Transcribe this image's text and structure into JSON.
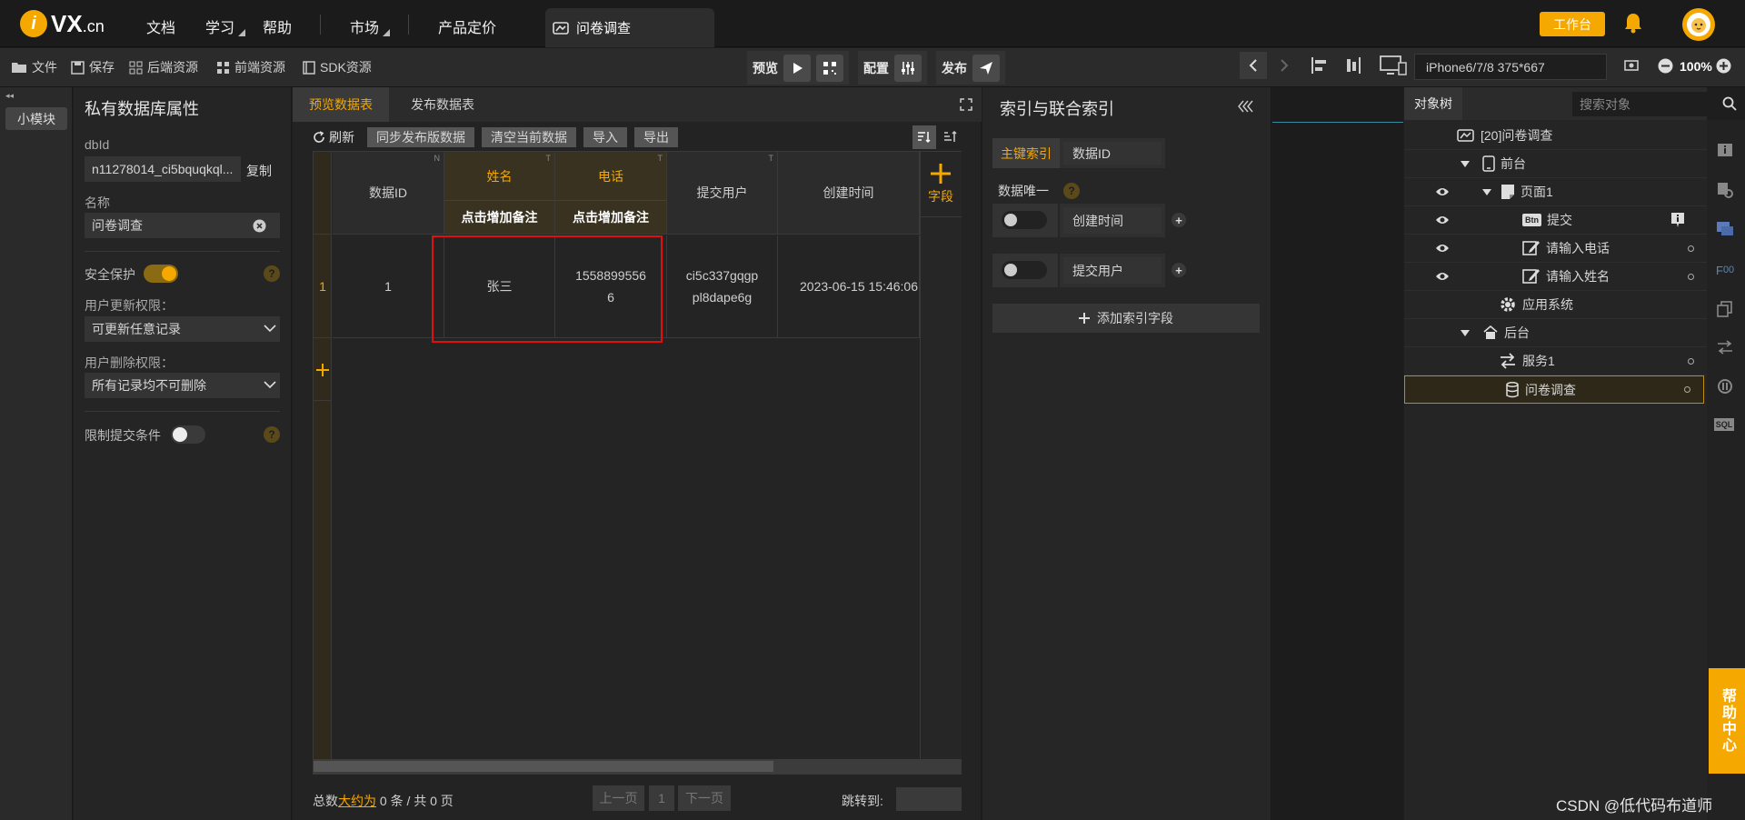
{
  "topnav": {
    "brand": "VX",
    "brand_suffix": ".cn",
    "links": [
      "文档",
      "学习",
      "帮助",
      "市场",
      "产品定价"
    ],
    "doc_tab": "问卷调查",
    "workbench": "工作台"
  },
  "toolbar": {
    "file": "文件",
    "save": "保存",
    "backend": "后端资源",
    "frontend": "前端资源",
    "sdk": "SDK资源",
    "preview": "预览",
    "config": "配置",
    "publish": "发布",
    "device": "iPhone6/7/8 375*667",
    "zoom": "100%"
  },
  "left": {
    "mini_module": "小模块"
  },
  "props": {
    "title": "私有数据库属性",
    "dbid_label": "dbId",
    "dbid_value": "n11278014_ci5bquqkql...",
    "copy": "复制",
    "name_label": "名称",
    "name_value": "问卷调查",
    "security_label": "安全保护",
    "security_on": true,
    "update_label": "用户更新权限：",
    "update_value": "可更新任意记录",
    "delete_label": "用户删除权限：",
    "delete_value": "所有记录均不可删除",
    "limit_label": "限制提交条件",
    "limit_on": false
  },
  "data": {
    "tabs": [
      "预览数据表",
      "发布数据表"
    ],
    "active_tab": 0,
    "refresh": "刷新",
    "actions": [
      "同步发布版数据",
      "清空当前数据",
      "导入",
      "导出"
    ],
    "columns": [
      {
        "name": "数据ID",
        "type": "N"
      },
      {
        "name": "姓名",
        "type": "T",
        "note": "点击增加备注"
      },
      {
        "name": "电话",
        "type": "T",
        "note": "点击增加备注"
      },
      {
        "name": "提交用户",
        "type": "T"
      },
      {
        "name": "创建时间",
        "type": ""
      }
    ],
    "rows": [
      {
        "idx": "1",
        "cells": [
          "1",
          "张三",
          "15588995566",
          "ci5c337gqgppl8dape6g",
          "2023-06-15 15:46:06"
        ]
      }
    ],
    "add_field": "字段",
    "footer": {
      "prefix": "总数",
      "approx": "大约为",
      "count": "0",
      "tail": "条 / 共 0 页",
      "prev": "上一页",
      "page": "1",
      "next": "下一页",
      "jump": "跳转到:"
    }
  },
  "index": {
    "title": "索引与联合索引",
    "pk_label": "主键索引",
    "pk_field": "数据ID",
    "unique_label": "数据唯一",
    "rows": [
      {
        "field": "创建时间",
        "unique": false
      },
      {
        "field": "提交用户",
        "unique": false
      }
    ],
    "add": "添加索引字段"
  },
  "tree": {
    "tab": "对象树",
    "search_placeholder": "搜索对象",
    "items": [
      {
        "label": "[20]问卷调查",
        "icon": "app-icon"
      },
      {
        "label": "前台",
        "icon": "phone-icon"
      },
      {
        "label": "页面1",
        "icon": "page-icon"
      },
      {
        "label": "提交",
        "icon": "btn-icon",
        "badge": "Btn"
      },
      {
        "label": "请输入电话",
        "icon": "edit-icon"
      },
      {
        "label": "请输入姓名",
        "icon": "edit-icon"
      },
      {
        "label": "应用系统",
        "icon": "gear-icon"
      },
      {
        "label": "后台",
        "icon": "server-icon"
      },
      {
        "label": "服务1",
        "icon": "service-icon"
      },
      {
        "label": "问卷调查",
        "icon": "database-icon"
      }
    ]
  },
  "help_center": "帮助中心",
  "watermark": "CSDN @低代码布道师",
  "colors": {
    "accent": "#f5a800",
    "highlight": "#e01010",
    "bg": "#1e1e1e"
  }
}
